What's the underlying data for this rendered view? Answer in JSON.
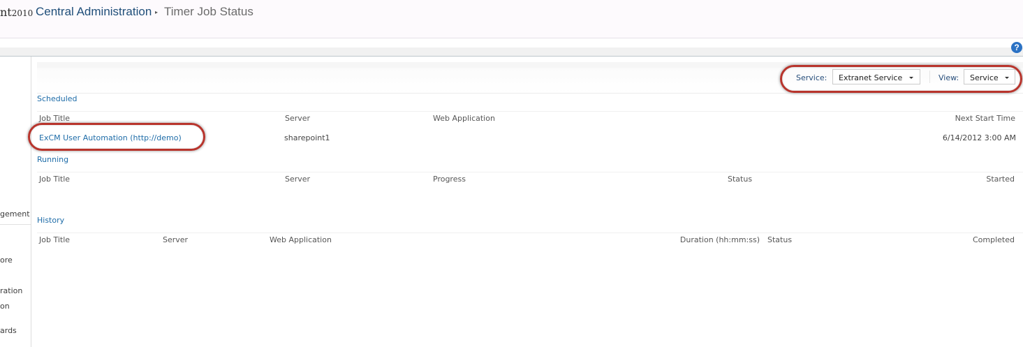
{
  "header": {
    "brand_partial": "nt",
    "brand_year": "2010",
    "breadcrumb_root": "Central Administration",
    "breadcrumb_separator": "▸",
    "breadcrumb_current": "Timer Job Status",
    "help_glyph": "?"
  },
  "left_nav": {
    "items": [
      "gement",
      "ore",
      "ration",
      "on",
      "ards"
    ]
  },
  "toolbar": {
    "service_label": "Service:",
    "service_value": "Extranet Service",
    "view_label": "View:",
    "view_value": "Service"
  },
  "scheduled": {
    "title": "Scheduled",
    "columns": [
      "Job Title",
      "Server",
      "Web Application",
      "Next Start Time"
    ],
    "rows": [
      {
        "job_title": "ExCM User Automation (http://demo)",
        "server": "sharepoint1",
        "web_application": "",
        "next_start": "6/14/2012 3:00 AM"
      }
    ]
  },
  "running": {
    "title": "Running",
    "columns": [
      "Job Title",
      "Server",
      "Progress",
      "Status",
      "Started"
    ]
  },
  "history": {
    "title": "History",
    "columns": [
      "Job Title",
      "Server",
      "Web Application",
      "Duration (hh:mm:ss)",
      "Status",
      "Completed"
    ]
  },
  "colors": {
    "link": "#1e6ca8",
    "highlight": "#b8342c",
    "help_icon": "#2b72c4"
  },
  "icons": {
    "help": "help-icon",
    "dropdown": "chevron-down-icon",
    "breadcrumb_sep": "breadcrumb-arrow-icon"
  }
}
